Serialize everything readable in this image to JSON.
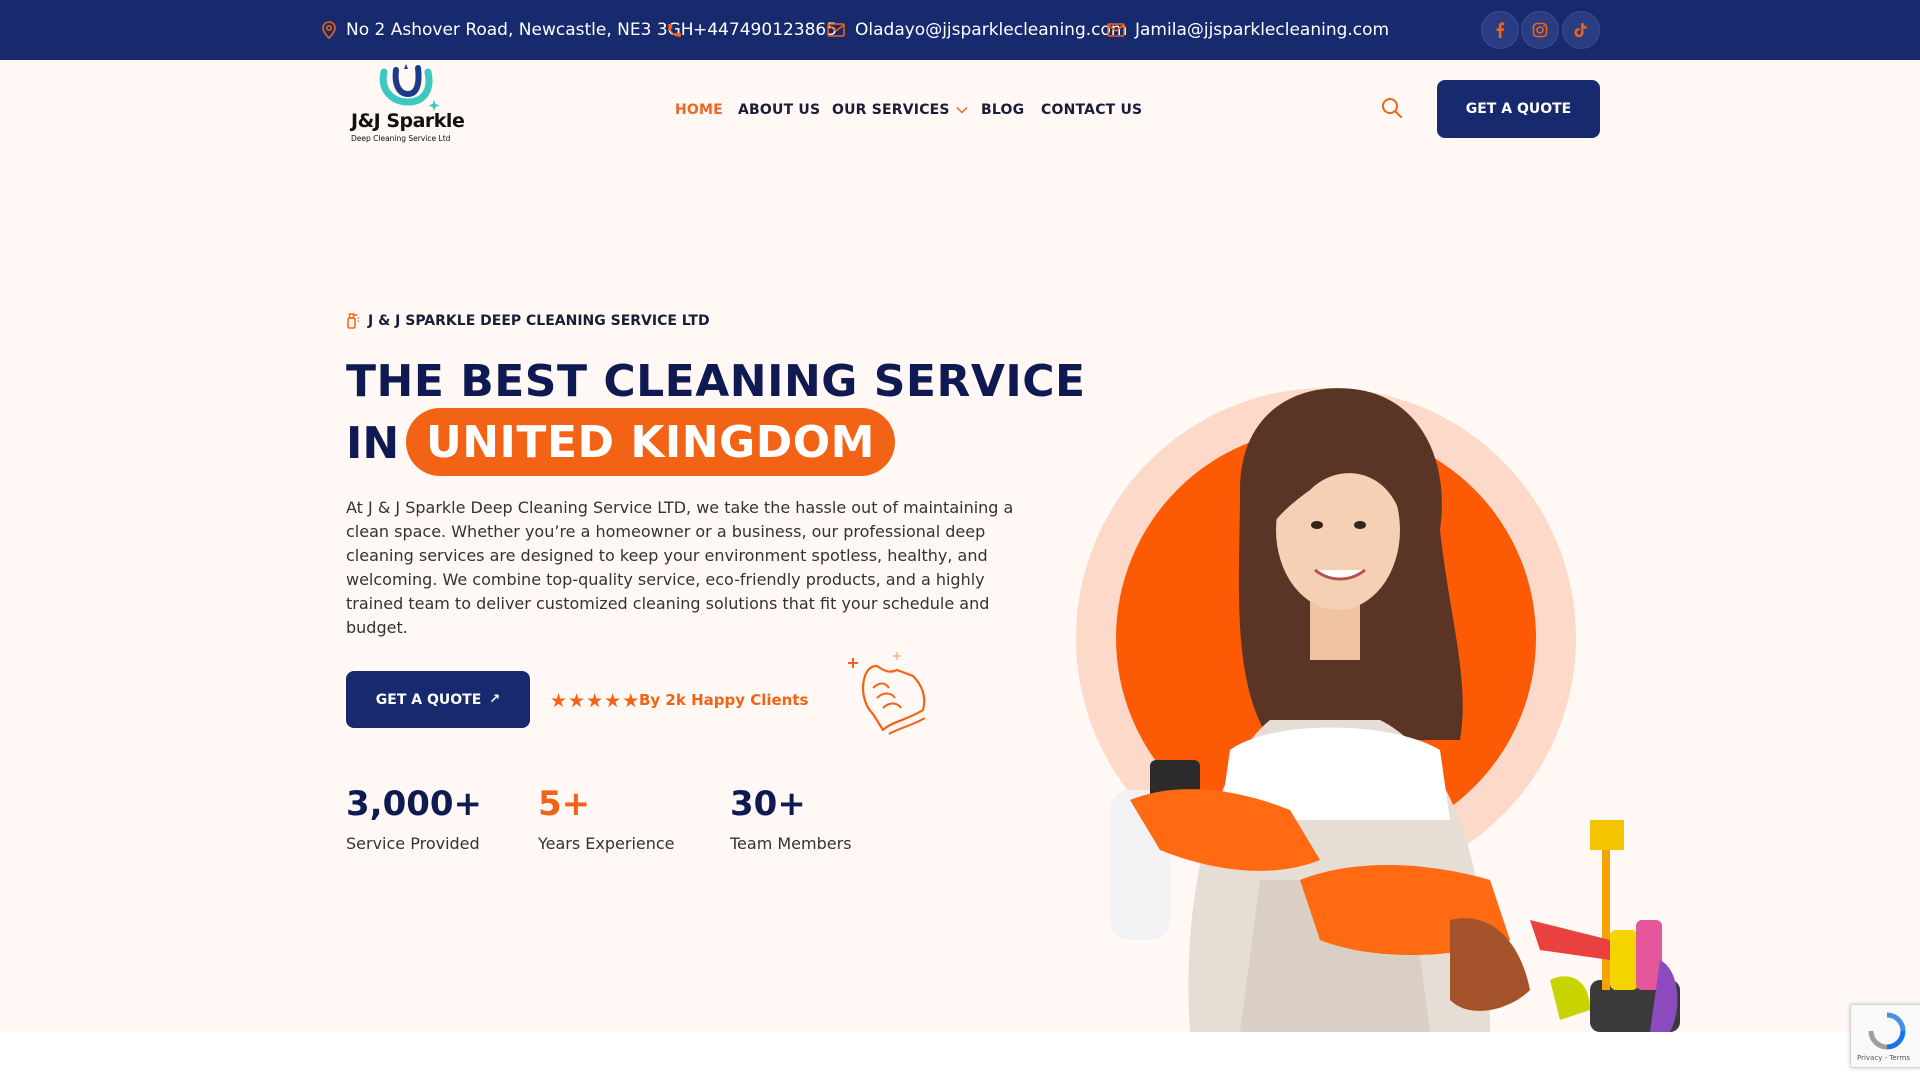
{
  "topbar": {
    "address": "No 2 Ashover Road, Newcastle, NE3 3GH",
    "phone": "+447490123865",
    "email1": "Oladayo@jjsparklecleaning.com",
    "email2": "Jamila@jjsparklecleaning.com",
    "social": [
      "facebook-icon",
      "instagram-icon",
      "tiktok-icon"
    ]
  },
  "logo": {
    "title": "J&J Sparkle",
    "subtitle": "Deep Cleaning Service Ltd"
  },
  "nav": {
    "items": [
      {
        "label": "HOME",
        "active": true
      },
      {
        "label": "ABOUT US"
      },
      {
        "label": "OUR SERVICES"
      },
      {
        "label": "BLOG"
      },
      {
        "label": "CONTACT US"
      }
    ],
    "quote_label": "GET A QUOTE"
  },
  "hero": {
    "tagline": "J & J SPARKLE DEEP CLEANING SERVICE LTD",
    "title_line1": "THE BEST CLEANING SERVICE",
    "title_in": "IN",
    "title_highlight": "UNITED KINGDOM",
    "description": "At J & J Sparkle Deep Cleaning Service LTD, we take the hassle out of maintaining a clean space. Whether you’re a homeowner or a business, our professional deep cleaning services are designed to keep your environment spotless, healthy, and welcoming. We combine top-quality service, eco-friendly products, and a highly trained team to deliver customized cleaning solutions that fit your schedule and budget.",
    "quote_label": "GET A QUOTE",
    "rating_stars": 5,
    "clients_text": "By 2k Happy Clients",
    "stats": [
      {
        "value": "3,000+",
        "label": "Service Provided"
      },
      {
        "value": "5+",
        "label": "Years Experience"
      },
      {
        "value": "30+",
        "label": "Team Members"
      }
    ]
  },
  "recaptcha": {
    "terms": "Privacy - Terms"
  },
  "colors": {
    "navy": "#172a6e",
    "orange": "#f26316",
    "cream": "#fff8f4"
  }
}
